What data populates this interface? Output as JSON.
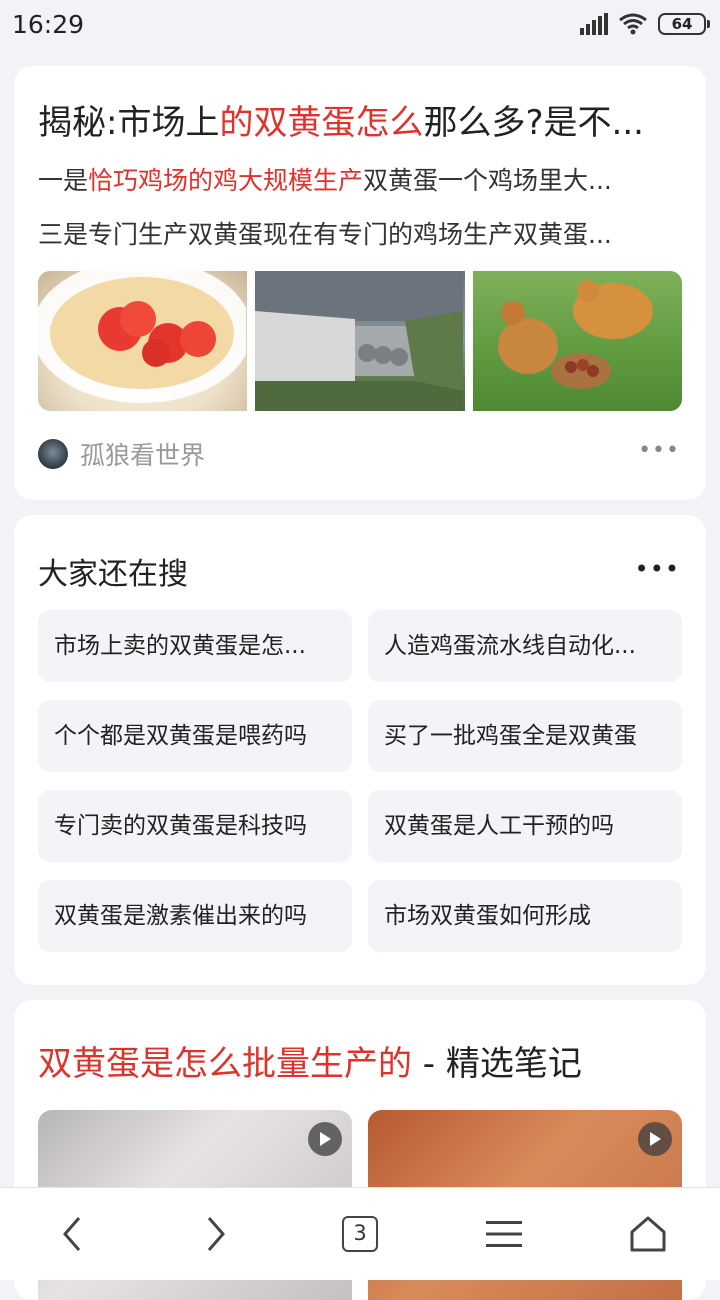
{
  "status_bar": {
    "time": "16:29",
    "battery": "64"
  },
  "result_card": {
    "headline_parts": [
      "揭秘:市场上",
      "的双黄蛋怎么",
      "那么多?是不..."
    ],
    "snippet1_parts": [
      "一是",
      "恰巧鸡场的鸡大规模生产",
      "双黄蛋一个鸡场里大..."
    ],
    "snippet2": "三是专门生产双黄蛋现在有专门的鸡场生产双黄蛋...",
    "author": "孤狼看世界",
    "more": "•••"
  },
  "related": {
    "title": "大家还在搜",
    "more": "•••",
    "items": [
      "市场上卖的双黄蛋是怎...",
      "人造鸡蛋流水线自动化...",
      "个个都是双黄蛋是喂药吗",
      "买了一批鸡蛋全是双黄蛋",
      "专门卖的双黄蛋是科技吗",
      "双黄蛋是人工干预的吗",
      "双黄蛋是激素催出来的吗",
      "市场双黄蛋如何形成"
    ]
  },
  "notes": {
    "title_red": "双黄蛋是怎么批量生产的",
    "title_rest": " - 精选笔记"
  },
  "bottom_bar": {
    "tab_count": "3"
  }
}
